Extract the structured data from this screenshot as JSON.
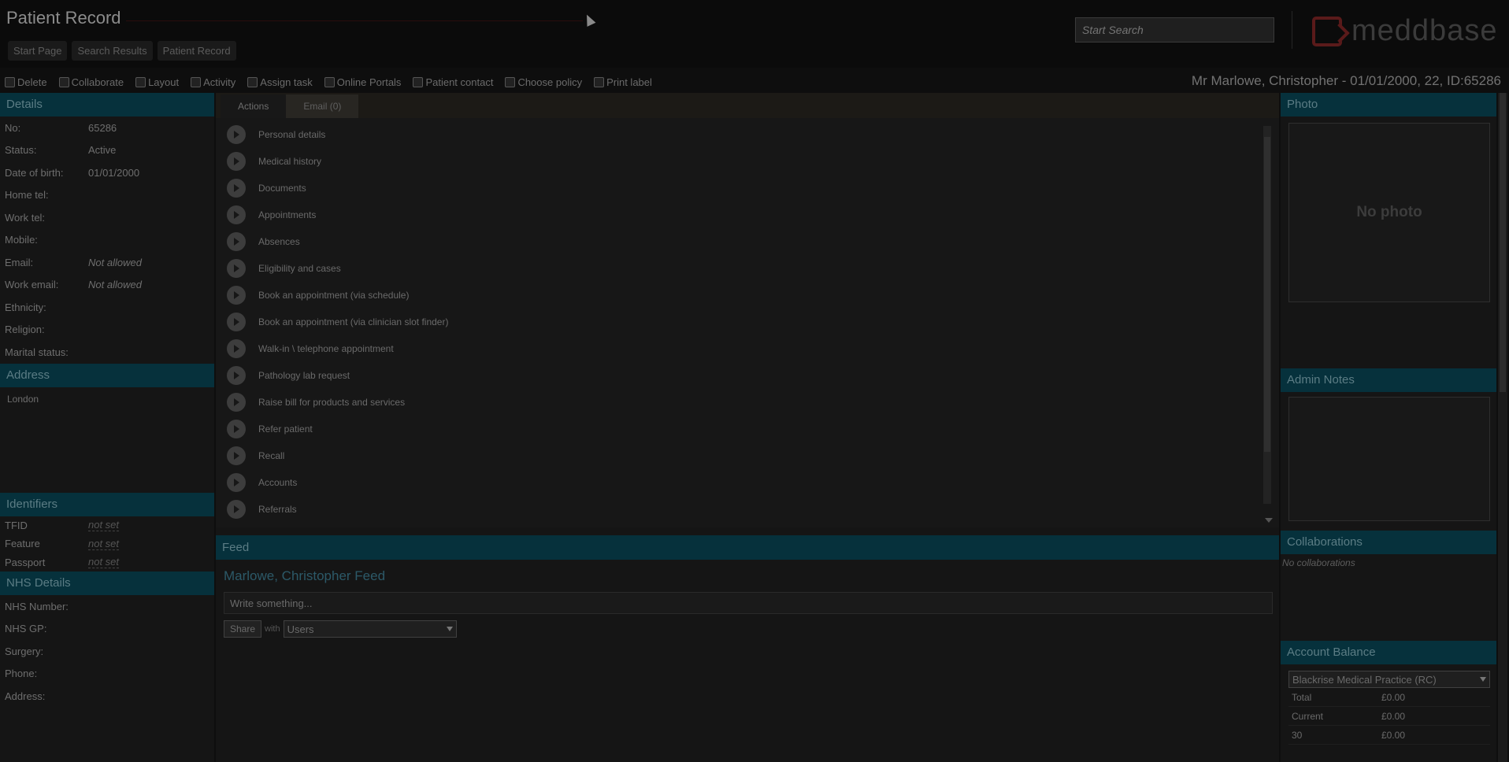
{
  "header": {
    "title": "Patient Record",
    "breadcrumbs": [
      "Start Page",
      "Search Results",
      "Patient Record"
    ],
    "search_placeholder": "Start Search",
    "logo_text": "meddbase"
  },
  "toolbar": {
    "items": [
      {
        "label": "Delete",
        "icon": "trash-icon"
      },
      {
        "label": "Collaborate",
        "icon": "collaborate-icon"
      },
      {
        "label": "Layout",
        "icon": "layout-icon"
      },
      {
        "label": "Activity",
        "icon": "activity-icon"
      },
      {
        "label": "Assign task",
        "icon": "task-icon"
      },
      {
        "label": "Online Portals",
        "icon": "globe-icon"
      },
      {
        "label": "Patient contact",
        "icon": "phone-icon"
      },
      {
        "label": "Choose policy",
        "icon": "lock-icon"
      },
      {
        "label": "Print label",
        "icon": "printer-icon"
      }
    ],
    "patient_summary": "Mr Marlowe, Christopher - 01/01/2000, 22, ID:65286"
  },
  "details": {
    "heading": "Details",
    "fields": [
      {
        "label": "No:",
        "value": "65286",
        "style": ""
      },
      {
        "label": "Status:",
        "value": "Active",
        "style": ""
      },
      {
        "label": "Date of birth:",
        "value": "01/01/2000",
        "style": ""
      },
      {
        "label": "Home tel:",
        "value": "",
        "style": ""
      },
      {
        "label": "Work tel:",
        "value": "",
        "style": ""
      },
      {
        "label": "Mobile:",
        "value": "",
        "style": ""
      },
      {
        "label": "Email:",
        "value": "Not allowed",
        "style": "italic"
      },
      {
        "label": "Work email:",
        "value": "Not allowed",
        "style": "italic"
      },
      {
        "label": "Ethnicity:",
        "value": "",
        "style": ""
      },
      {
        "label": "Religion:",
        "value": "",
        "style": ""
      },
      {
        "label": "Marital status:",
        "value": "",
        "style": ""
      }
    ]
  },
  "address": {
    "heading": "Address",
    "text": "London"
  },
  "identifiers": {
    "heading": "Identifiers",
    "fields": [
      {
        "label": "TFID",
        "value": "not set"
      },
      {
        "label": "Feature",
        "value": "not set"
      },
      {
        "label": "Passport",
        "value": "not set"
      }
    ]
  },
  "nhs": {
    "heading": "NHS Details",
    "fields": [
      "NHS Number:",
      "NHS GP:",
      "Surgery:",
      "Phone:",
      "Address:"
    ]
  },
  "tabs": [
    "Actions",
    "Email (0)"
  ],
  "actions": [
    "Personal details",
    "Medical history",
    "Documents",
    "Appointments",
    "Absences",
    "Eligibility and cases",
    "Book an appointment (via schedule)",
    "Book an appointment (via clinician slot finder)",
    "Walk-in \\ telephone appointment",
    "Pathology lab request",
    "Raise bill for products and services",
    "Refer patient",
    "Recall",
    "Accounts",
    "Referrals"
  ],
  "feed": {
    "heading": "Feed",
    "title": "Marlowe, Christopher Feed",
    "input_value": "Write something...",
    "share_label": "Share",
    "with_label": "with",
    "audience": "Users"
  },
  "photo": {
    "heading": "Photo",
    "empty_text": "No photo"
  },
  "admin_notes": {
    "heading": "Admin Notes"
  },
  "collaborations": {
    "heading": "Collaborations",
    "empty_text": "No collaborations"
  },
  "account_balance": {
    "heading": "Account Balance",
    "practice": "Blackrise Medical Practice (RC)",
    "rows": [
      {
        "label": "Total",
        "value": "£0.00"
      },
      {
        "label": "Current",
        "value": "£0.00"
      },
      {
        "label": "30",
        "value": "£0.00"
      }
    ]
  }
}
